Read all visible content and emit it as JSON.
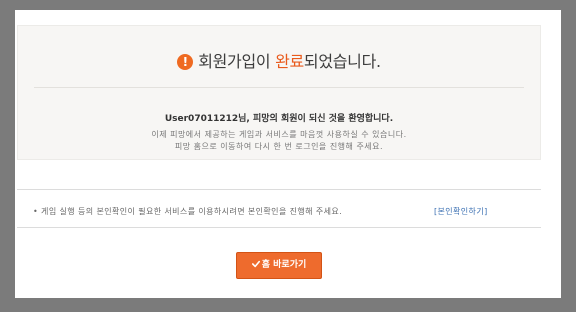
{
  "notice": {
    "title_prefix": "회원가입이 ",
    "title_accent": "완료",
    "title_suffix": "되었습니다.",
    "icon": "exclamation-circle-icon",
    "welcome": "User07011212님, 피망의 회원이 되신 것을 환영합니다.",
    "info_line1": "이제 피망에서 제공하는 게임과 서비스를 마음껏 사용하실 수 있습니다.",
    "info_line2": "피망 홈으로 이동하여 다시 한 번 로그인을 진행해 주세요."
  },
  "verify": {
    "text": "• 게임 실행 등의 본인확인이 필요한 서비스를 이용하시려면 본인확인을 진행해 주세요.",
    "link": "[본인확인하기]"
  },
  "home_button": {
    "label": "홈 바로가기",
    "icon": "check-icon"
  },
  "colors": {
    "accent": "#e95a1c",
    "button": "#ee6b2d",
    "link": "#3a6fb2",
    "backdrop": "#7b7b7b"
  }
}
